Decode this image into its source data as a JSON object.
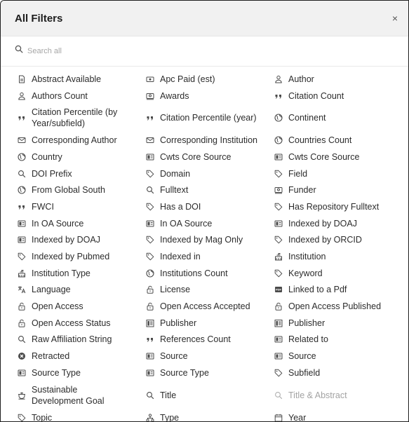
{
  "dialog": {
    "title": "All Filters",
    "close_label": "×"
  },
  "search": {
    "placeholder": "Search all",
    "value": ""
  },
  "filters": [
    {
      "label": "Abstract Available",
      "icon": "document-icon"
    },
    {
      "label": "Apc Paid (est)",
      "icon": "money-icon"
    },
    {
      "label": "Author",
      "icon": "person-icon"
    },
    {
      "label": "Authors Count",
      "icon": "person-icon"
    },
    {
      "label": "Awards",
      "icon": "award-icon"
    },
    {
      "label": "Citation Count",
      "icon": "quote-icon"
    },
    {
      "label": "Citation Percentile (by Year/subfield)",
      "icon": "quote-icon"
    },
    {
      "label": "Citation Percentile (year)",
      "icon": "quote-icon"
    },
    {
      "label": "Continent",
      "icon": "globe-icon"
    },
    {
      "label": "Corresponding Author",
      "icon": "mail-icon"
    },
    {
      "label": "Corresponding Institution",
      "icon": "mail-icon"
    },
    {
      "label": "Countries Count",
      "icon": "globe-icon"
    },
    {
      "label": "Country",
      "icon": "globe-icon"
    },
    {
      "label": "Cwts Core Source",
      "icon": "source-icon"
    },
    {
      "label": "Cwts Core Source",
      "icon": "source-icon"
    },
    {
      "label": "DOI Prefix",
      "icon": "search-icon"
    },
    {
      "label": "Domain",
      "icon": "tag-icon"
    },
    {
      "label": "Field",
      "icon": "tag-icon"
    },
    {
      "label": "From Global South",
      "icon": "globe-icon"
    },
    {
      "label": "Fulltext",
      "icon": "search-icon"
    },
    {
      "label": "Funder",
      "icon": "award-icon"
    },
    {
      "label": "FWCI",
      "icon": "quote-icon"
    },
    {
      "label": "Has a DOI",
      "icon": "tag-icon"
    },
    {
      "label": "Has Repository Fulltext",
      "icon": "tag-icon"
    },
    {
      "label": "In OA Source",
      "icon": "source-icon"
    },
    {
      "label": "In OA Source",
      "icon": "source-icon"
    },
    {
      "label": "Indexed by DOAJ",
      "icon": "source-icon"
    },
    {
      "label": "Indexed by DOAJ",
      "icon": "source-icon"
    },
    {
      "label": "Indexed by Mag Only",
      "icon": "tag-icon"
    },
    {
      "label": "Indexed by ORCID",
      "icon": "tag-icon"
    },
    {
      "label": "Indexed by Pubmed",
      "icon": "tag-icon"
    },
    {
      "label": "Indexed in",
      "icon": "tag-icon"
    },
    {
      "label": "Institution",
      "icon": "institution-icon"
    },
    {
      "label": "Institution Type",
      "icon": "institution-icon"
    },
    {
      "label": "Institutions Count",
      "icon": "globe-icon"
    },
    {
      "label": "Keyword",
      "icon": "tag-icon"
    },
    {
      "label": "Language",
      "icon": "language-icon"
    },
    {
      "label": "License",
      "icon": "lock-icon"
    },
    {
      "label": "Linked to a Pdf",
      "icon": "pdf-icon"
    },
    {
      "label": "Open Access",
      "icon": "lock-icon"
    },
    {
      "label": "Open Access Accepted",
      "icon": "lock-icon"
    },
    {
      "label": "Open Access Published",
      "icon": "lock-icon"
    },
    {
      "label": "Open Access Status",
      "icon": "lock-icon"
    },
    {
      "label": "Publisher",
      "icon": "publisher-icon"
    },
    {
      "label": "Publisher",
      "icon": "publisher-icon"
    },
    {
      "label": "Raw Affiliation String",
      "icon": "search-icon"
    },
    {
      "label": "References Count",
      "icon": "quote-icon"
    },
    {
      "label": "Related to",
      "icon": "source-icon"
    },
    {
      "label": "Retracted",
      "icon": "cancel-icon"
    },
    {
      "label": "Source",
      "icon": "source-icon"
    },
    {
      "label": "Source",
      "icon": "source-icon"
    },
    {
      "label": "Source Type",
      "icon": "source-icon"
    },
    {
      "label": "Source Type",
      "icon": "source-icon"
    },
    {
      "label": "Subfield",
      "icon": "tag-icon"
    },
    {
      "label": "Sustainable Development Goal",
      "icon": "sdg-icon"
    },
    {
      "label": "Title",
      "icon": "search-icon"
    },
    {
      "label": "Title & Abstract",
      "icon": "search-icon",
      "disabled": true
    },
    {
      "label": "Topic",
      "icon": "tag-icon"
    },
    {
      "label": "Type",
      "icon": "type-icon"
    },
    {
      "label": "Year",
      "icon": "calendar-icon"
    }
  ],
  "colors": {
    "header_bg": "#f1f1f1",
    "text": "#2c2c2c",
    "disabled_text": "#a3a3a3"
  }
}
